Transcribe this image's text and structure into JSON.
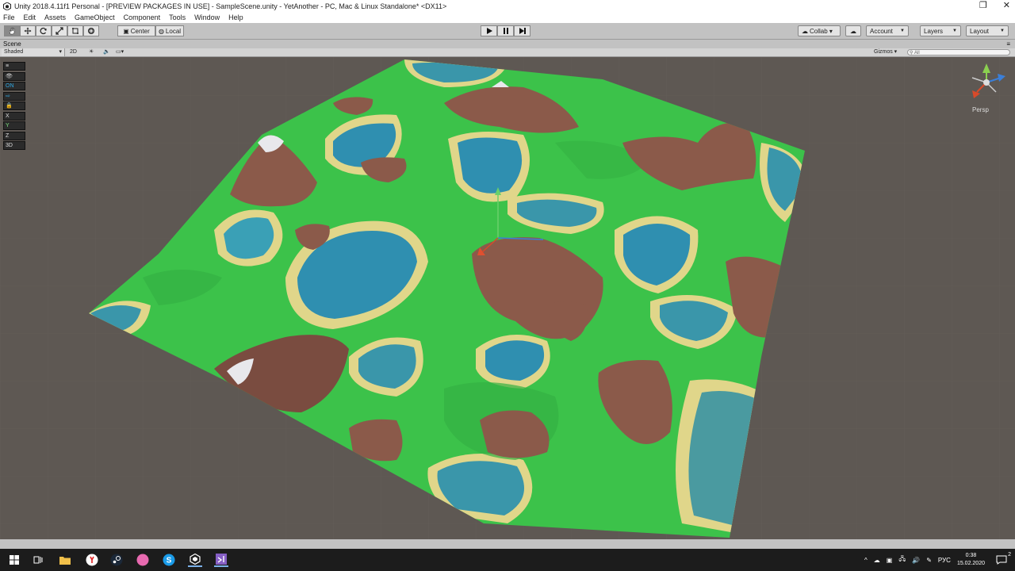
{
  "window": {
    "title": "Unity 2018.4.11f1 Personal - [PREVIEW PACKAGES IN USE] - SampleScene.unity - YetAnother - PC, Mac & Linux Standalone* <DX11>",
    "controls": [
      "❐",
      "✕"
    ]
  },
  "menu": {
    "items": [
      "File",
      "Edit",
      "Assets",
      "GameObject",
      "Component",
      "Tools",
      "Window",
      "Help"
    ]
  },
  "toolbar": {
    "tools": [
      {
        "name": "hand-tool-icon"
      },
      {
        "name": "move-tool-icon"
      },
      {
        "name": "rotate-tool-icon"
      },
      {
        "name": "scale-tool-icon"
      },
      {
        "name": "rect-tool-icon"
      },
      {
        "name": "transform-tool-icon"
      }
    ],
    "pivot_label": "Center",
    "handle_label": "Local",
    "play_icons": [
      "play-icon",
      "pause-icon",
      "step-icon"
    ],
    "collab_label": "Collab ▾",
    "account_label": "Account",
    "layers_label": "Layers",
    "layout_label": "Layout"
  },
  "scene": {
    "tab_label": "Scene",
    "shading_mode": "Shaded",
    "mode_2d": "2D",
    "gizmos_label": "Gizmos ▾",
    "search_placeholder": "All",
    "persp_label": "Persp",
    "tool_rows": [
      "≡",
      "👁",
      "ON",
      "⇨",
      "🔒",
      "X",
      "Y",
      "Z",
      "3D"
    ]
  },
  "taskbar": {
    "lang": "РУС",
    "time": "0:38",
    "date": "15.02.2020",
    "notifications": "2"
  }
}
